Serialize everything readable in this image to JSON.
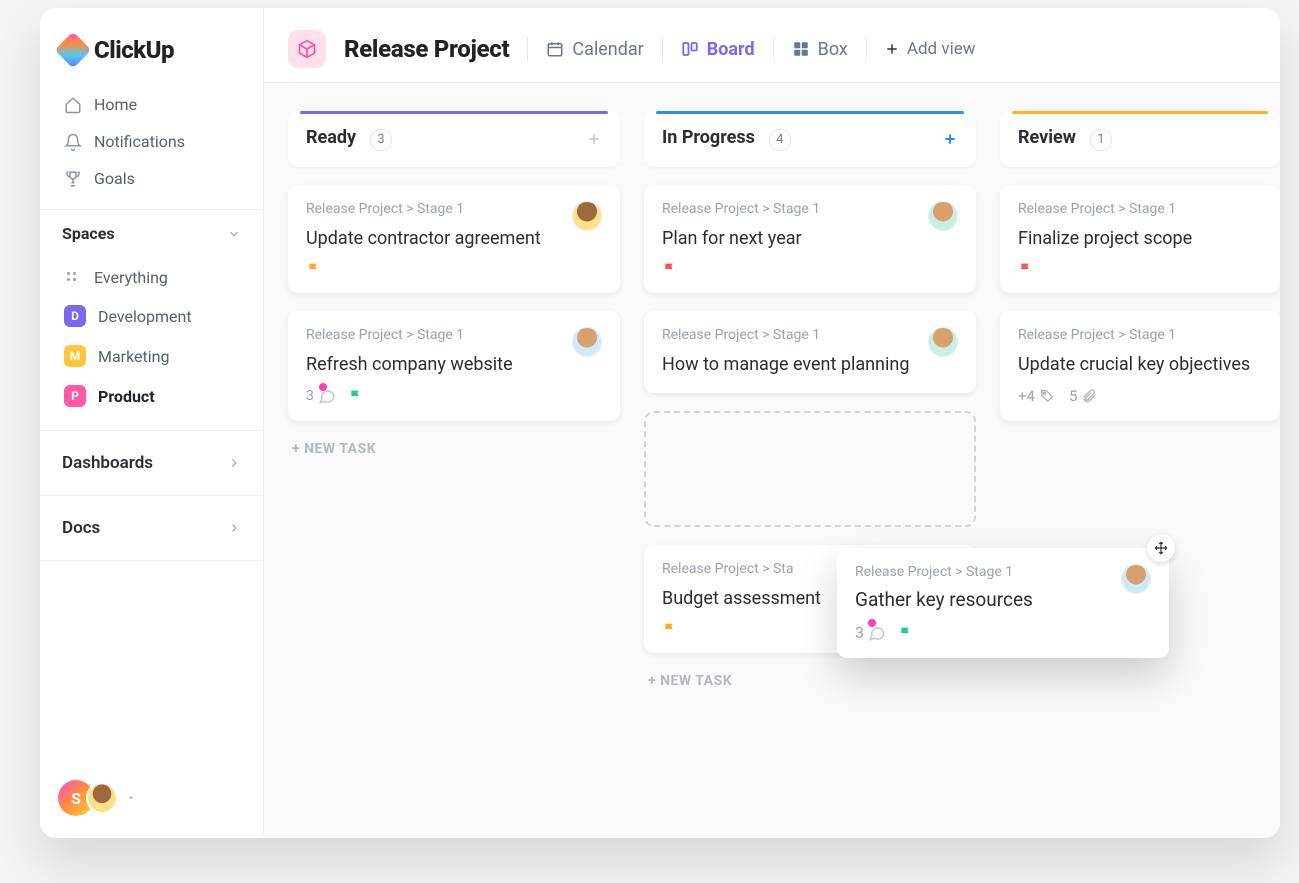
{
  "brand": {
    "name": "ClickUp"
  },
  "sidebar": {
    "nav": [
      {
        "label": "Home"
      },
      {
        "label": "Notifications"
      },
      {
        "label": "Goals"
      }
    ],
    "spaces_header": "Spaces",
    "everything": "Everything",
    "spaces": [
      {
        "label": "Development",
        "letter": "D",
        "color": "purple"
      },
      {
        "label": "Marketing",
        "letter": "M",
        "color": "yellow"
      },
      {
        "label": "Product",
        "letter": "P",
        "color": "pink",
        "active": true
      }
    ],
    "dashboards": "Dashboards",
    "docs": "Docs",
    "footer_letter": "S"
  },
  "topbar": {
    "project": "Release Project",
    "views": {
      "calendar": "Calendar",
      "board": "Board",
      "box": "Box",
      "add": "Add view"
    }
  },
  "board": {
    "new_task": "+ NEW TASK",
    "columns": [
      {
        "title": "Ready",
        "count": "3",
        "stripe": "purple",
        "cards": [
          {
            "crumb": "Release Project > Stage 1",
            "title": "Update contractor agreement",
            "flag": "orange",
            "avatar": "ring-yellow"
          },
          {
            "crumb": "Release Project > Stage 1",
            "title": "Refresh company website",
            "comments": "3",
            "flag": "green",
            "avatar": "ring-blue"
          }
        ]
      },
      {
        "title": "In Progress",
        "count": "4",
        "stripe": "blue",
        "add_accent": true,
        "cards": [
          {
            "crumb": "Release Project > Stage 1",
            "title": "Plan for next year",
            "flag": "red",
            "avatar": "ring-teal"
          },
          {
            "crumb": "Release Project > Stage 1",
            "title": "How to manage event planning",
            "avatar": "ring-teal"
          }
        ],
        "after_cards": [
          {
            "crumb": "Release Project > Sta",
            "title": "Budget assessment",
            "flag": "orange"
          }
        ]
      },
      {
        "title": "Review",
        "count": "1",
        "stripe": "yellow",
        "cards": [
          {
            "crumb": "Release Project > Stage 1",
            "title": "Finalize project scope",
            "flag": "red"
          },
          {
            "crumb": "Release Project > Stage 1",
            "title": "Update crucial key objectives",
            "sub_extra": "+4",
            "sub_att": "5"
          }
        ]
      }
    ],
    "dragging": {
      "crumb": "Release Project > Stage 1",
      "title": "Gather key resources",
      "comments": "3",
      "flag": "green",
      "avatar": "ring-blue"
    }
  }
}
